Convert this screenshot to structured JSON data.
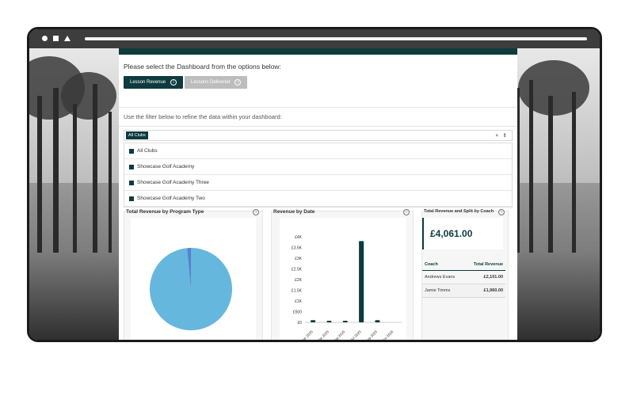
{
  "header": {
    "prompt": "Please select the Dashboard from the options below:",
    "tabs": [
      {
        "label": "Lesson Revenue",
        "active": true
      },
      {
        "label": "Lessons Delivered",
        "active": false
      }
    ],
    "filter_instruction": "Use the filter below to refine the data within your dashboard:"
  },
  "filter": {
    "selected_chip": "All Clubs",
    "clear_icon": "×",
    "toggle_icon": "⇕",
    "options": [
      "All Clubs",
      "Showcase Golf Academy",
      "Showcase Golf Academy Three",
      "Showcase Golf Academy Two"
    ]
  },
  "cards": {
    "program": {
      "title": "Total Revenue by Program Type"
    },
    "date": {
      "title": "Revenue by Date"
    },
    "coach": {
      "title": "Total Revenue and Split by Coach"
    }
  },
  "summary": {
    "total_value": "£4,061.00"
  },
  "coach_table": {
    "headers": [
      "Coach",
      "Total Revenue"
    ],
    "rows": [
      [
        "Andrews Evans",
        "£2,101.00"
      ],
      [
        "Jamie Timms",
        "£1,960.00"
      ]
    ]
  },
  "colors": {
    "accent": "#0e3b3e",
    "pie": "#66b7dd",
    "pie_slice": "#5b7fd1"
  },
  "chart_data": [
    {
      "type": "pie",
      "title": "Total Revenue by Program Type",
      "values": [
        98.5,
        1.5
      ]
    },
    {
      "type": "bar",
      "title": "Revenue by Date",
      "categories": [
        "Jan 2025",
        "Mar 2025",
        "May 2025",
        "Jul 2025",
        "Sep 2025",
        "Nov 2025"
      ],
      "values": [
        100,
        60,
        70,
        3800,
        100,
        0
      ],
      "y_ticks": [
        "£0",
        "£500",
        "£1K",
        "£1.5K",
        "£2K",
        "£2.5K",
        "£3K",
        "£3.5K",
        "£4K"
      ],
      "ylim": [
        0,
        4000
      ]
    }
  ]
}
